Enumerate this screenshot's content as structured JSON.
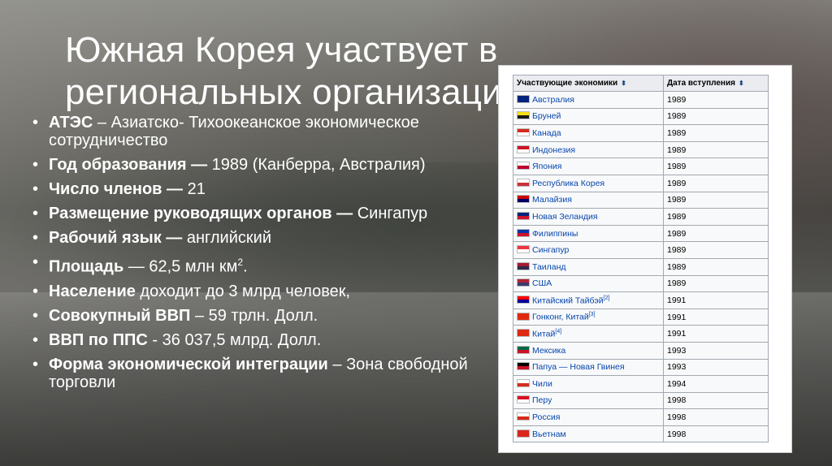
{
  "title": {
    "line1": "Южная Корея участвует в",
    "line2": "региональных организациях"
  },
  "bullets": [
    {
      "bold": "АТЭС",
      "text": " – Азиатско- Тихоокеанское экономическое сотрудничество"
    },
    {
      "bold": "Год образования —",
      "text": " 1989 (Канберра, Австралия)"
    },
    {
      "bold": "Число членов —",
      "text": " 21"
    },
    {
      "bold": "Размещение руководящих органов —",
      "text": " Сингапур"
    },
    {
      "bold": "Рабочий язык —",
      "text": " английский"
    },
    {
      "bold": "Площадь",
      "text": " — 62,5 млн км",
      "sup": "2",
      "tail": "."
    },
    {
      "bold": "Население",
      "text": " доходит до 3 млрд человек,"
    },
    {
      "bold": "Совокупный ВВП",
      "text": " – 59  трлн. Долл."
    },
    {
      "bold": "ВВП по ППС",
      "text": " - 36 037,5 млрд. Долл."
    },
    {
      "bold": "Форма экономической интеграции",
      "text": " – Зона свободной торговли"
    }
  ],
  "table": {
    "headers": [
      "Участвующие экономики",
      "Дата вступления"
    ],
    "sort_icon": "⬍",
    "rows": [
      {
        "name": "Австралия",
        "year": "1989",
        "flag": [
          "#00247d",
          "#00247d"
        ],
        "ref": ""
      },
      {
        "name": "Бруней",
        "year": "1989",
        "flag": [
          "#f7e017",
          "#1a1a1a"
        ],
        "ref": ""
      },
      {
        "name": "Канада",
        "year": "1989",
        "flag": [
          "#d52b1e",
          "#ffffff"
        ],
        "ref": ""
      },
      {
        "name": "Индонезия",
        "year": "1989",
        "flag": [
          "#ce1126",
          "#ffffff"
        ],
        "ref": ""
      },
      {
        "name": "Япония",
        "year": "1989",
        "flag": [
          "#ffffff",
          "#bc002d"
        ],
        "ref": ""
      },
      {
        "name": "Республика Корея",
        "year": "1989",
        "flag": [
          "#ffffff",
          "#cd2e3a"
        ],
        "ref": ""
      },
      {
        "name": "Малайзия",
        "year": "1989",
        "flag": [
          "#cc0001",
          "#010066"
        ],
        "ref": ""
      },
      {
        "name": "Новая Зеландия",
        "year": "1989",
        "flag": [
          "#00247d",
          "#cc142b"
        ],
        "ref": ""
      },
      {
        "name": "Филиппины",
        "year": "1989",
        "flag": [
          "#0038a8",
          "#ce1126"
        ],
        "ref": ""
      },
      {
        "name": "Сингапур",
        "year": "1989",
        "flag": [
          "#ef3340",
          "#ffffff"
        ],
        "ref": ""
      },
      {
        "name": "Таиланд",
        "year": "1989",
        "flag": [
          "#a51931",
          "#2d2a4a"
        ],
        "ref": ""
      },
      {
        "name": "США",
        "year": "1989",
        "flag": [
          "#b22234",
          "#3c3b6e"
        ],
        "ref": ""
      },
      {
        "name": "Китайский Тайбэй",
        "year": "1991",
        "flag": [
          "#fe0000",
          "#000095"
        ],
        "ref": "[2]"
      },
      {
        "name": "Гонконг, Китай",
        "year": "1991",
        "flag": [
          "#de2910",
          "#de2910"
        ],
        "ref": "[3]"
      },
      {
        "name": "Китай",
        "year": "1991",
        "flag": [
          "#de2910",
          "#de2910"
        ],
        "ref": "[4]"
      },
      {
        "name": "Мексика",
        "year": "1993",
        "flag": [
          "#006847",
          "#ce1126"
        ],
        "ref": ""
      },
      {
        "name": "Папуа — Новая Гвинея",
        "year": "1993",
        "flag": [
          "#000000",
          "#ce1126"
        ],
        "ref": ""
      },
      {
        "name": "Чили",
        "year": "1994",
        "flag": [
          "#ffffff",
          "#d52b1e"
        ],
        "ref": ""
      },
      {
        "name": "Перу",
        "year": "1998",
        "flag": [
          "#d91023",
          "#ffffff"
        ],
        "ref": ""
      },
      {
        "name": "Россия",
        "year": "1998",
        "flag": [
          "#ffffff",
          "#d52b1e"
        ],
        "ref": ""
      },
      {
        "name": "Вьетнам",
        "year": "1998",
        "flag": [
          "#da251d",
          "#da251d"
        ],
        "ref": ""
      }
    ]
  }
}
